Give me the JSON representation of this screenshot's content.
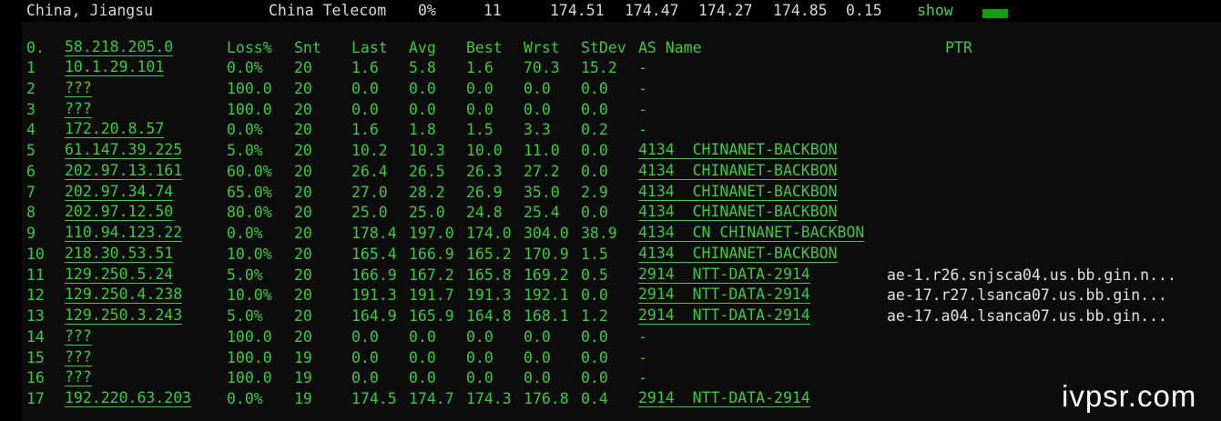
{
  "topbar": {
    "location": "China, Jiangsu",
    "isp": "China Telecom",
    "loss": "0%",
    "snt": "11",
    "last": "174.51",
    "avg": "174.47",
    "best": "174.27",
    "wrst": "174.85",
    "stdev": "0.15",
    "show_label": "show"
  },
  "headers": {
    "idx": "0.",
    "host": "58.218.205.0",
    "loss": "Loss%",
    "snt": "Snt",
    "last": "Last",
    "avg": "Avg",
    "best": "Best",
    "wrst": "Wrst",
    "stdev": "StDev",
    "as": "AS Name",
    "ptr": "PTR"
  },
  "hops": [
    {
      "idx": "1",
      "host": "10.1.29.101",
      "loss": "0.0%",
      "snt": "20",
      "last": "1.6",
      "avg": "5.8",
      "best": "1.6",
      "wrst": "70.3",
      "stdev": "15.2",
      "as": "-",
      "ptr": ""
    },
    {
      "idx": "2",
      "host": "???",
      "loss": "100.0",
      "snt": "20",
      "last": "0.0",
      "avg": "0.0",
      "best": "0.0",
      "wrst": "0.0",
      "stdev": "0.0",
      "as": "-",
      "ptr": ""
    },
    {
      "idx": "3",
      "host": "???",
      "loss": "100.0",
      "snt": "20",
      "last": "0.0",
      "avg": "0.0",
      "best": "0.0",
      "wrst": "0.0",
      "stdev": "0.0",
      "as": "-",
      "ptr": ""
    },
    {
      "idx": "4",
      "host": "172.20.8.57",
      "loss": "0.0%",
      "snt": "20",
      "last": "1.6",
      "avg": "1.8",
      "best": "1.5",
      "wrst": "3.3",
      "stdev": "0.2",
      "as": "-",
      "ptr": ""
    },
    {
      "idx": "5",
      "host": "61.147.39.225",
      "loss": "5.0%",
      "snt": "20",
      "last": "10.2",
      "avg": "10.3",
      "best": "10.0",
      "wrst": "11.0",
      "stdev": "0.0",
      "as": "4134  CHINANET-BACKBON",
      "ptr": ""
    },
    {
      "idx": "6",
      "host": "202.97.13.161",
      "loss": "60.0%",
      "snt": "20",
      "last": "26.4",
      "avg": "26.5",
      "best": "26.3",
      "wrst": "27.2",
      "stdev": "0.0",
      "as": "4134  CHINANET-BACKBON",
      "ptr": ""
    },
    {
      "idx": "7",
      "host": "202.97.34.74",
      "loss": "65.0%",
      "snt": "20",
      "last": "27.0",
      "avg": "28.2",
      "best": "26.9",
      "wrst": "35.0",
      "stdev": "2.9",
      "as": "4134  CHINANET-BACKBON",
      "ptr": ""
    },
    {
      "idx": "8",
      "host": "202.97.12.50",
      "loss": "80.0%",
      "snt": "20",
      "last": "25.0",
      "avg": "25.0",
      "best": "24.8",
      "wrst": "25.4",
      "stdev": "0.0",
      "as": "4134  CHINANET-BACKBON",
      "ptr": ""
    },
    {
      "idx": "9",
      "host": "110.94.123.22",
      "loss": "0.0%",
      "snt": "20",
      "last": "178.4",
      "avg": "197.0",
      "best": "174.0",
      "wrst": "304.0",
      "stdev": "38.9",
      "as": "4134  CN CHINANET-BACKBON",
      "ptr": ""
    },
    {
      "idx": "10",
      "host": "218.30.53.51",
      "loss": "10.0%",
      "snt": "20",
      "last": "165.4",
      "avg": "166.9",
      "best": "165.2",
      "wrst": "170.9",
      "stdev": "1.5",
      "as": "4134  CHINANET-BACKBON",
      "ptr": ""
    },
    {
      "idx": "11",
      "host": "129.250.5.24",
      "loss": "5.0%",
      "snt": "20",
      "last": "166.9",
      "avg": "167.2",
      "best": "165.8",
      "wrst": "169.2",
      "stdev": "0.5",
      "as": "2914  NTT-DATA-2914",
      "ptr": "ae-1.r26.snjsca04.us.bb.gin.n..."
    },
    {
      "idx": "12",
      "host": "129.250.4.238",
      "loss": "10.0%",
      "snt": "20",
      "last": "191.3",
      "avg": "191.7",
      "best": "191.3",
      "wrst": "192.1",
      "stdev": "0.0",
      "as": "2914  NTT-DATA-2914",
      "ptr": "ae-17.r27.lsanca07.us.bb.gin..."
    },
    {
      "idx": "13",
      "host": "129.250.3.243",
      "loss": "5.0%",
      "snt": "20",
      "last": "164.9",
      "avg": "165.9",
      "best": "164.8",
      "wrst": "168.1",
      "stdev": "1.2",
      "as": "2914  NTT-DATA-2914",
      "ptr": "ae-17.a04.lsanca07.us.bb.gin..."
    },
    {
      "idx": "14",
      "host": "???",
      "loss": "100.0",
      "snt": "20",
      "last": "0.0",
      "avg": "0.0",
      "best": "0.0",
      "wrst": "0.0",
      "stdev": "0.0",
      "as": "-",
      "ptr": ""
    },
    {
      "idx": "15",
      "host": "???",
      "loss": "100.0",
      "snt": "19",
      "last": "0.0",
      "avg": "0.0",
      "best": "0.0",
      "wrst": "0.0",
      "stdev": "0.0",
      "as": "-",
      "ptr": ""
    },
    {
      "idx": "16",
      "host": "???",
      "loss": "100.0",
      "snt": "19",
      "last": "0.0",
      "avg": "0.0",
      "best": "0.0",
      "wrst": "0.0",
      "stdev": "0.0",
      "as": "-",
      "ptr": ""
    },
    {
      "idx": "17",
      "host": "192.220.63.203",
      "loss": "0.0%",
      "snt": "19",
      "last": "174.5",
      "avg": "174.7",
      "best": "174.3",
      "wrst": "176.8",
      "stdev": "0.4",
      "as": "2914  NTT-DATA-2914",
      "ptr": ""
    }
  ],
  "watermark": "ivpsr.com",
  "colors": {
    "text": "#3ec93e",
    "background": "#000000",
    "panel": "#0c0c0c",
    "bar": "#11a011"
  }
}
